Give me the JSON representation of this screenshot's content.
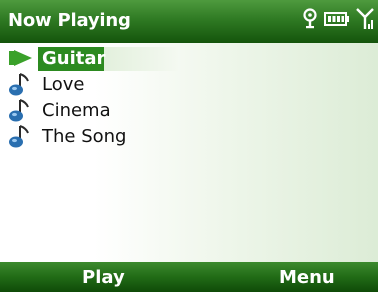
{
  "header": {
    "title": "Now Playing",
    "icons": [
      "connectivity-icon",
      "battery-icon",
      "signal-icon"
    ]
  },
  "playlist": {
    "items": [
      {
        "label": "Guitar",
        "icon": "play-arrow-icon",
        "selected": true
      },
      {
        "label": "Love",
        "icon": "music-note-icon",
        "selected": false
      },
      {
        "label": "Cinema",
        "icon": "music-note-icon",
        "selected": false
      },
      {
        "label": "The Song",
        "icon": "music-note-icon",
        "selected": false
      }
    ]
  },
  "softkeys": {
    "left": "Play",
    "right": "Menu"
  },
  "colors": {
    "accent": "#2c8a20",
    "titlebar": "#2f7a23",
    "note_icon": "#2a6fb0"
  }
}
